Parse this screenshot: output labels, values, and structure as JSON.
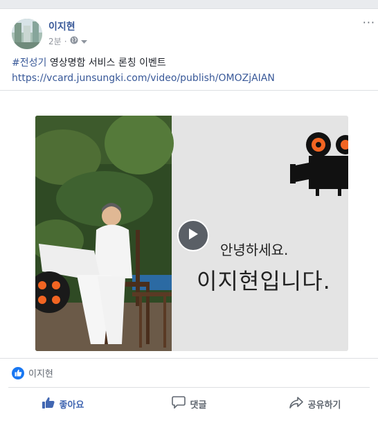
{
  "post": {
    "author": "이지현",
    "timestamp": "2분",
    "more_label": "···",
    "text": {
      "hashtag": "#전성기",
      "body": " 영상명함 서비스 론칭 이벤트",
      "link": "https://vcard.junsungki.com/video/publish/OMOZjAIAN"
    },
    "video": {
      "greeting": "안녕하세요.",
      "name_line": "이지현입니다."
    },
    "reactions": {
      "names": "이지현"
    },
    "actions": {
      "like": "좋아요",
      "comment": "댓글",
      "share": "공유하기"
    }
  },
  "colors": {
    "link": "#385898",
    "like_blue": "#1877f2",
    "muted": "#606770"
  }
}
